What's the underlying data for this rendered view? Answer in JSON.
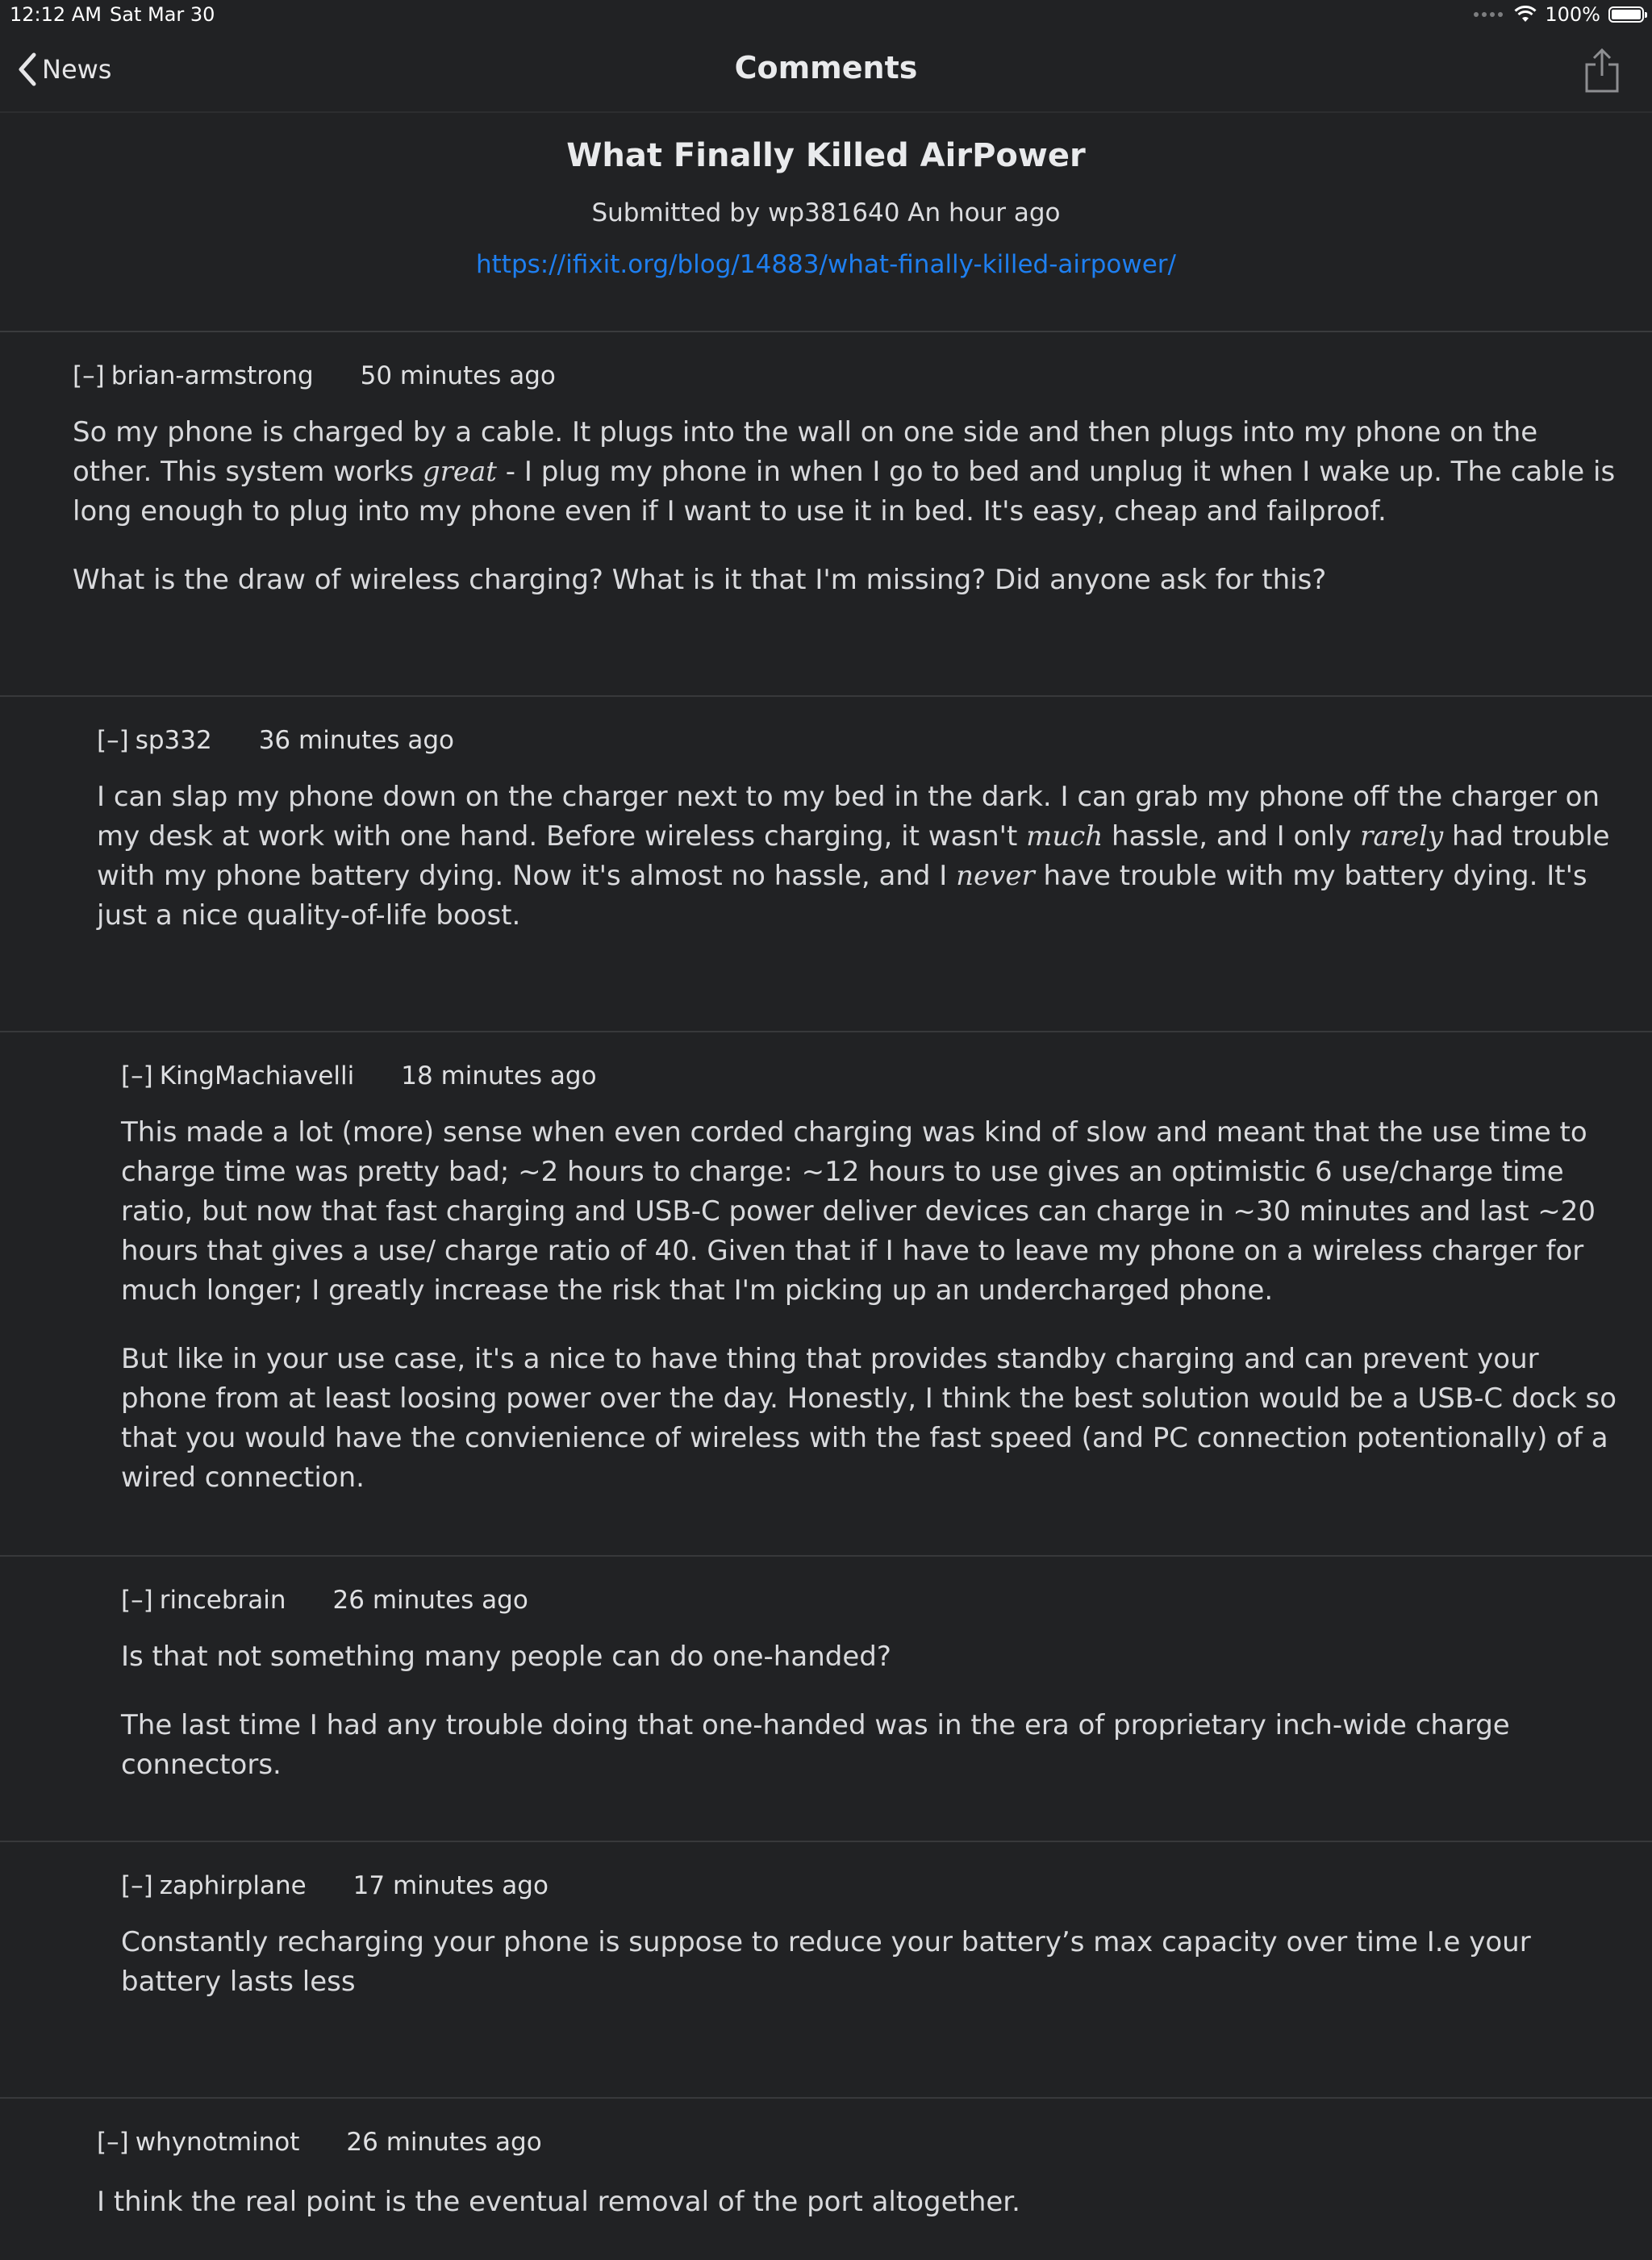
{
  "status_bar": {
    "time": "12:12 AM",
    "date": "Sat Mar 30",
    "battery": "100%"
  },
  "nav": {
    "back_label": "News",
    "title": "Comments"
  },
  "article": {
    "title": "What Finally Killed AirPower",
    "meta": "Submitted by wp381640 An hour ago",
    "url": "https://ifixit.org/blog/14883/what-finally-killed-airpower/"
  },
  "comments": [
    {
      "toggle": "[–]",
      "author": "brian-armstrong",
      "time": "50 minutes ago",
      "p1": [
        "So my phone is charged by a cable. It plugs into the wall on one side and then plugs into my phone on the other. This system works ",
        "great",
        " - I plug my phone in when I go to bed and unplug it when I wake up. The cable is long enough to plug into my phone even if I want to use it in bed. It's easy, cheap and failproof."
      ],
      "p2": "What is the draw of wireless charging? What is it that I'm missing? Did anyone ask for this?"
    },
    {
      "toggle": "[–]",
      "author": "sp332",
      "time": "36 minutes ago",
      "p1": [
        "I can slap my phone down on the charger next to my bed in the dark. I can grab my phone off the charger on my desk at work with one hand. Before wireless charging, it wasn't ",
        "much",
        " hassle, and I only ",
        "rarely",
        " had trouble with my phone battery dying. Now it's almost no hassle, and I ",
        "never",
        " have trouble with my battery dying. It's just a nice quality-of-life boost."
      ]
    },
    {
      "toggle": "[–]",
      "author": "KingMachiavelli",
      "time": "18 minutes ago",
      "p1": "This made a lot (more) sense when even corded charging was kind of slow and meant that the use time to charge time was pretty bad; ~2 hours to charge: ~12 hours to use gives an optimistic 6 use/charge time ratio, but now that fast charging and USB-C power deliver devices can charge in ~30 minutes and last ~20 hours that gives a use/ charge ratio of 40. Given that if I have to leave my phone on a wireless charger for much longer; I greatly increase the risk that I'm picking up an undercharged phone.",
      "p2": "But like in your use case, it's a nice to have thing that provides standby charging and can prevent your phone from at least loosing power over the day. Honestly, I think the best solution would be a USB-C dock so that you would have the convienience of wireless with the fast speed (and PC connection potentionally) of a wired connection."
    },
    {
      "toggle": "[–]",
      "author": "rincebrain",
      "time": "26 minutes ago",
      "p1": "Is that not something many people can do one-handed?",
      "p2": "The last time I had any trouble doing that one-handed was in the era of proprietary inch-wide charge connectors."
    },
    {
      "toggle": "[–]",
      "author": "zaphirplane",
      "time": "17 minutes ago",
      "p1": "Constantly recharging your phone is suppose to reduce your battery’s max capacity over time I.e your battery lasts less"
    },
    {
      "toggle": "[–]",
      "author": "whynotminot",
      "time": "26 minutes ago",
      "p1": "I think the real point is the eventual removal of the port altogether."
    }
  ]
}
